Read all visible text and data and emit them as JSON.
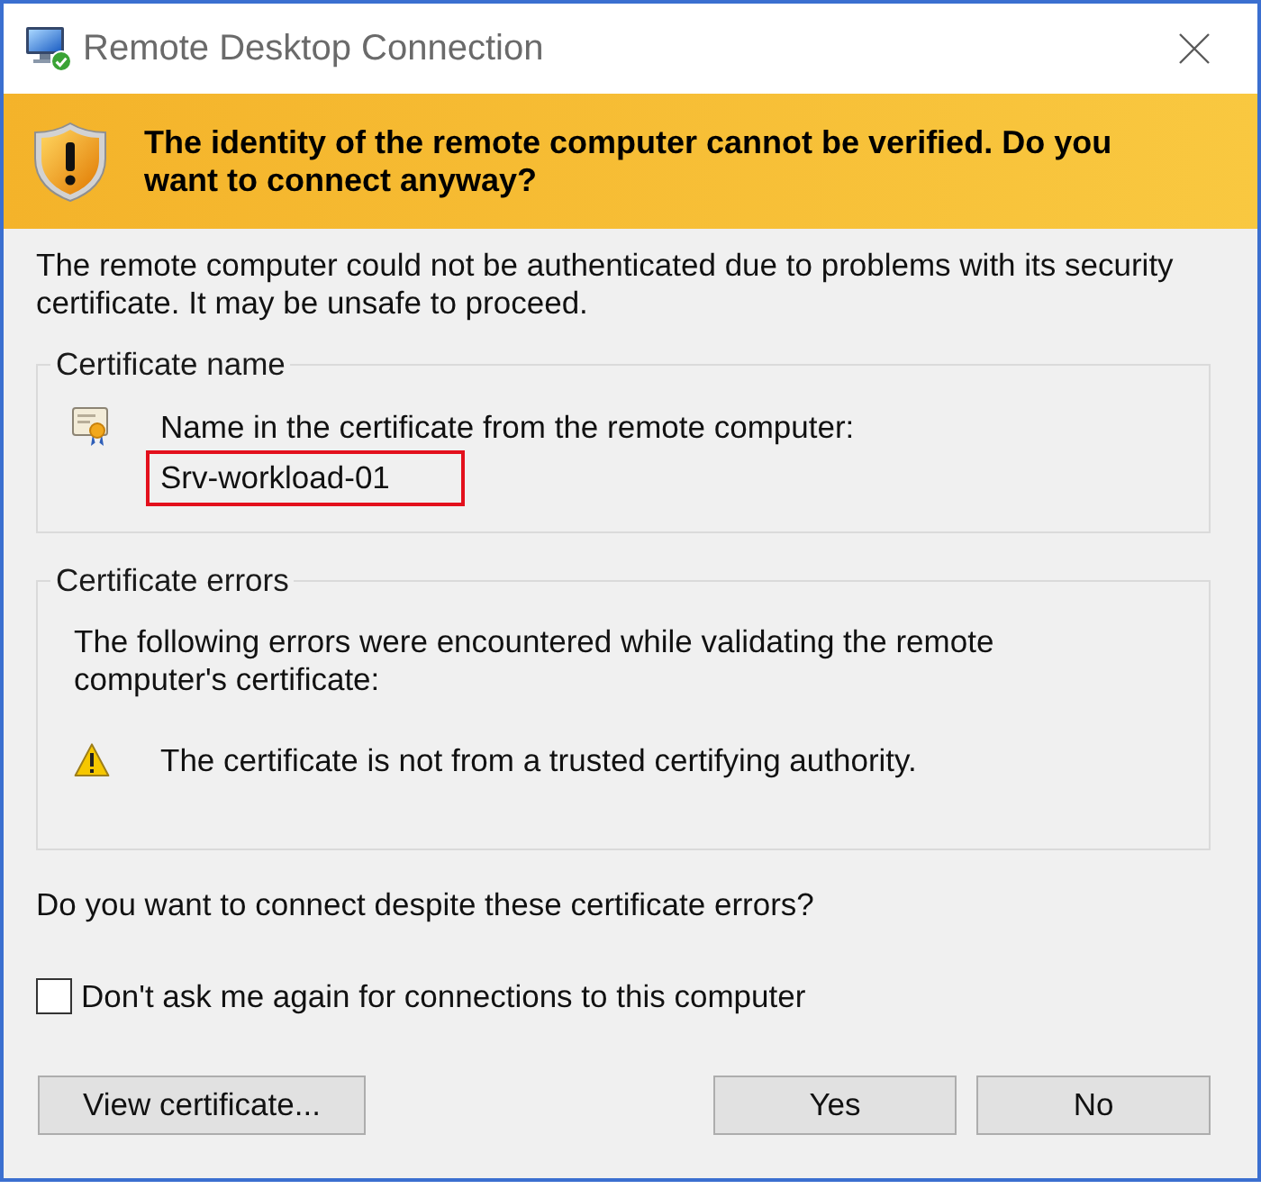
{
  "window": {
    "title": "Remote Desktop Connection"
  },
  "banner": {
    "message": "The identity of the remote computer cannot be verified. Do you want to connect anyway?"
  },
  "description": "The remote computer could not be authenticated due to problems with its security certificate. It may be unsafe to proceed.",
  "certificate_name": {
    "legend": "Certificate name",
    "label": "Name in the certificate from the remote computer:",
    "value": "Srv-workload-01",
    "highlighted": true
  },
  "certificate_errors": {
    "legend": "Certificate errors",
    "intro": "The following errors were encountered while validating the remote computer's certificate:",
    "errors": [
      "The certificate is not from a trusted certifying authority."
    ]
  },
  "question": "Do you want to connect despite these certificate errors?",
  "checkbox": {
    "label": "Don't ask me again for connections to this computer",
    "checked": false
  },
  "buttons": [
    {
      "label": "View certificate..."
    },
    {
      "label": "Yes"
    },
    {
      "label": "No"
    }
  ]
}
